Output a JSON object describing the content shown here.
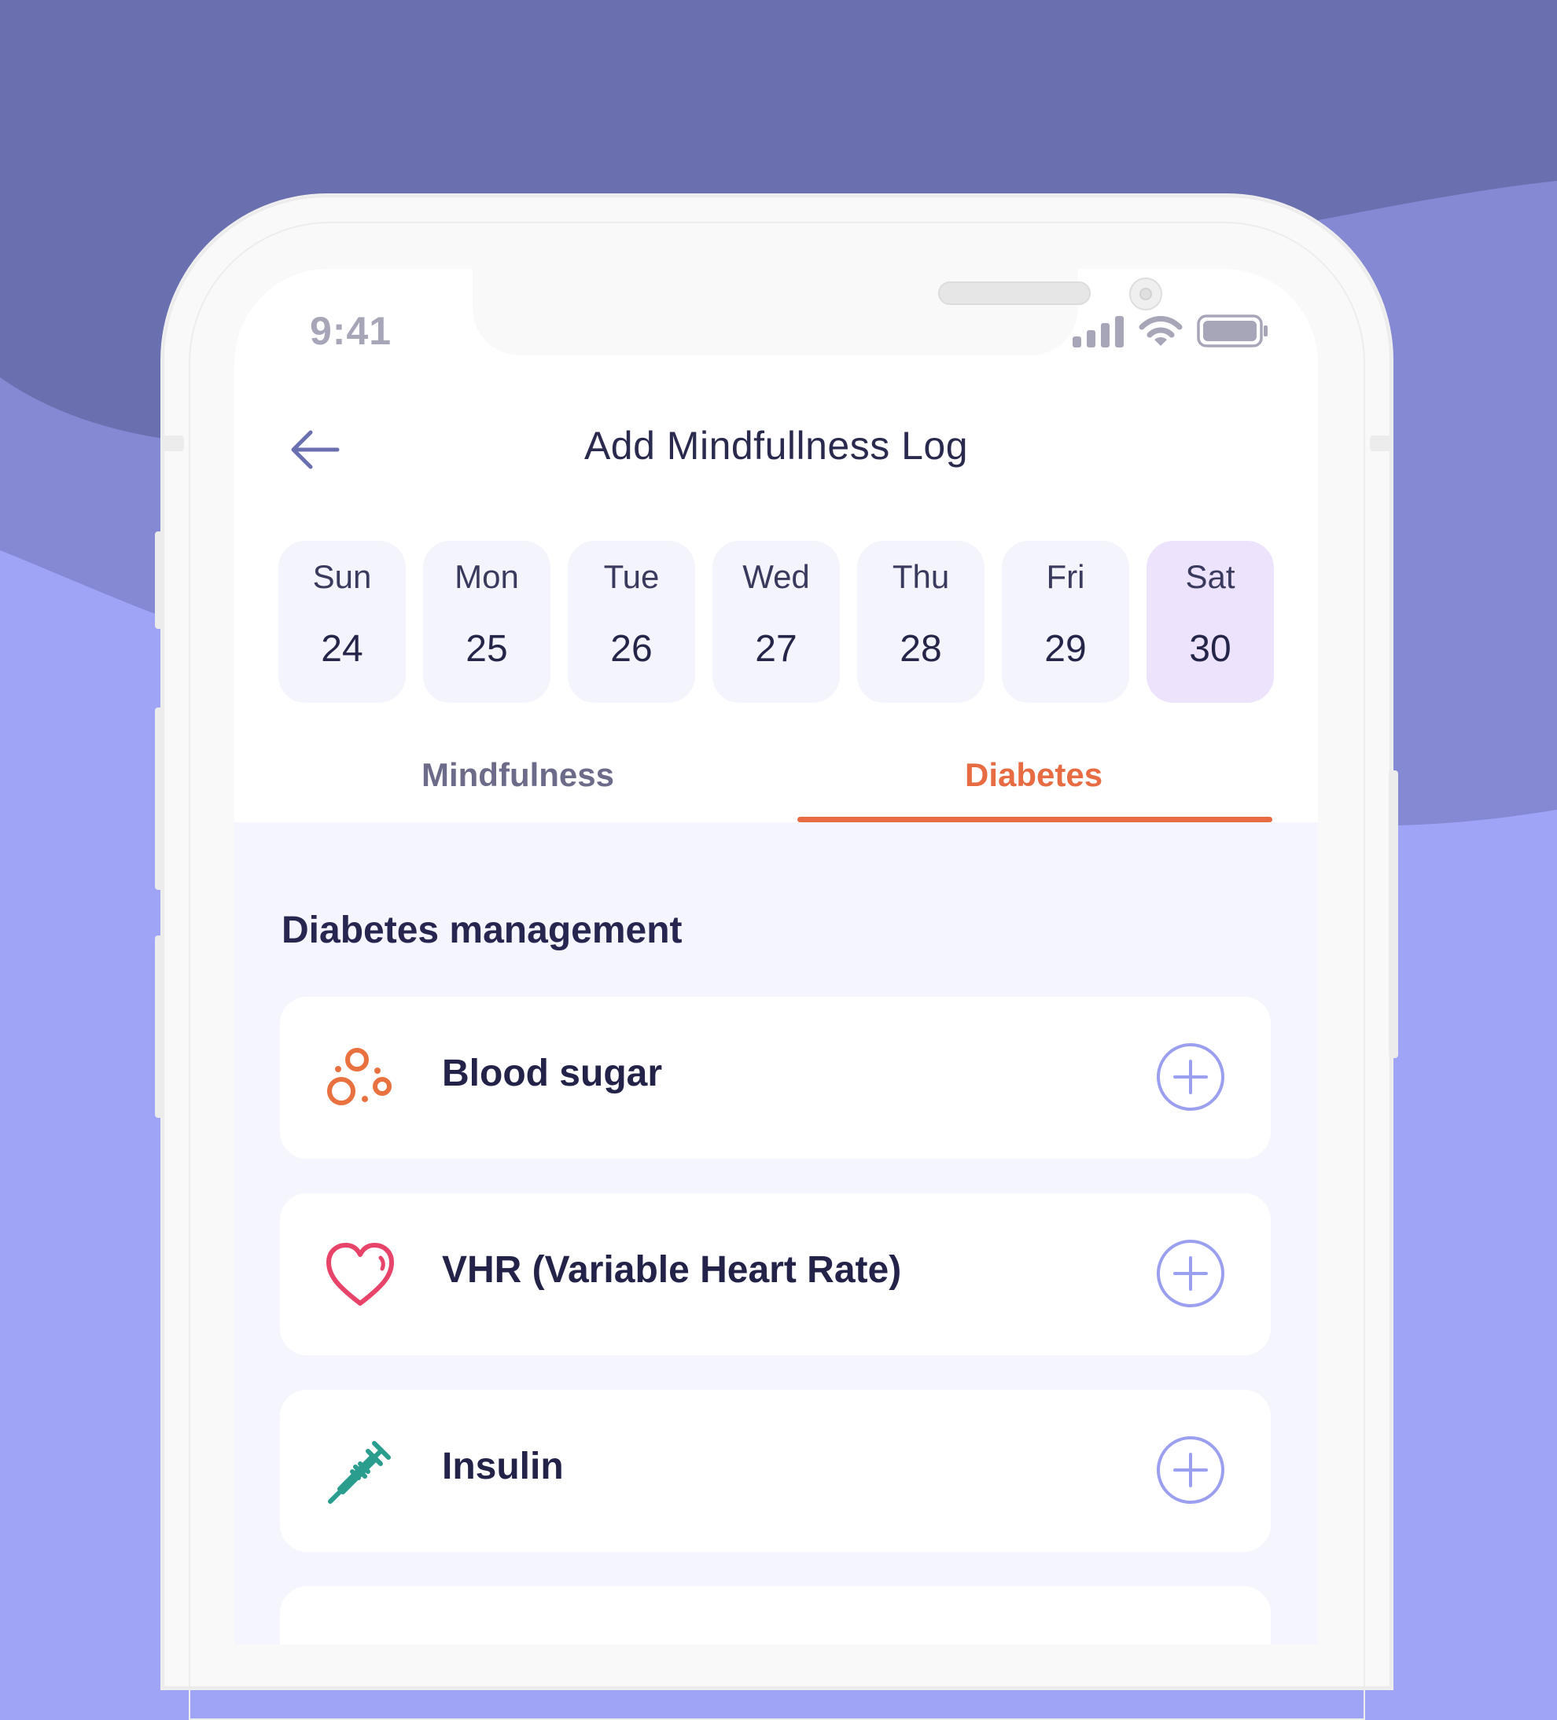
{
  "status_bar": {
    "time": "9:41"
  },
  "header": {
    "title": "Add Mindfullness Log",
    "back_icon": "arrow-left-icon"
  },
  "days": [
    {
      "name": "Sun",
      "date": "24",
      "selected": false
    },
    {
      "name": "Mon",
      "date": "25",
      "selected": false
    },
    {
      "name": "Tue",
      "date": "26",
      "selected": false
    },
    {
      "name": "Wed",
      "date": "27",
      "selected": false
    },
    {
      "name": "Thu",
      "date": "28",
      "selected": false
    },
    {
      "name": "Fri",
      "date": "29",
      "selected": false
    },
    {
      "name": "Sat",
      "date": "30",
      "selected": true
    }
  ],
  "tabs": [
    {
      "label": "Mindfulness",
      "active": false
    },
    {
      "label": "Diabetes",
      "active": true
    }
  ],
  "section": {
    "title": "Diabetes management"
  },
  "items": [
    {
      "label": "Blood sugar",
      "icon": "blood-drops-icon",
      "color": "#e8713f"
    },
    {
      "label": "VHR (Variable Heart Rate)",
      "icon": "heart-icon",
      "color": "#e8446a"
    },
    {
      "label": "Insulin",
      "icon": "syringe-icon",
      "color": "#2a9d8f"
    }
  ],
  "colors": {
    "accent": "#e86c43",
    "add_button": "#9b9ff0",
    "selected_day": "#ede3fc",
    "background_dark": "#6a6fb0",
    "background_light": "#a0a4f6"
  }
}
